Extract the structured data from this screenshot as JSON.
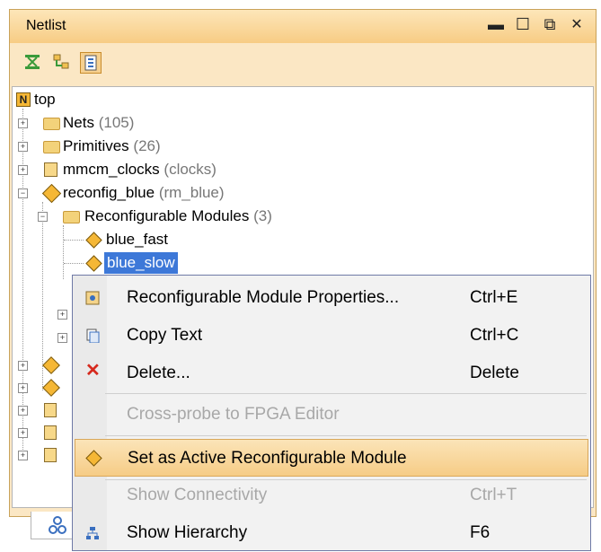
{
  "panel": {
    "title": "Netlist",
    "window_controls": [
      "minimize",
      "maximize",
      "restore",
      "close"
    ]
  },
  "toolbar": {
    "buttons": [
      {
        "icon": "collapse-all-icon"
      },
      {
        "icon": "expand-all-icon"
      },
      {
        "icon": "show-hierarchy-icon",
        "active": true
      }
    ]
  },
  "tree": {
    "root": {
      "label": "top",
      "icon": "netlist-n-icon"
    },
    "items": [
      {
        "label": "Nets",
        "count": "(105)",
        "icon": "folder-icon"
      },
      {
        "label": "Primitives",
        "count": "(26)",
        "icon": "folder-icon"
      },
      {
        "label": "mmcm_clocks",
        "count": "(clocks)",
        "icon": "instance-icon"
      },
      {
        "label": "reconfig_blue",
        "count": "(rm_blue)",
        "icon": "reconfig-partition-icon"
      },
      {
        "label": "Reconfigurable Modules",
        "count": "(3)",
        "icon": "folder-icon"
      },
      {
        "label": "blue_fast",
        "icon": "reconfig-module-icon"
      },
      {
        "label": "blue_slow",
        "icon": "reconfig-module-icon",
        "selected": true
      }
    ]
  },
  "context_menu": {
    "items": [
      {
        "label": "Reconfigurable Module Properties...",
        "shortcut": "Ctrl+E",
        "icon": "properties-icon",
        "enabled": true
      },
      {
        "label": "Copy Text",
        "shortcut": "Ctrl+C",
        "icon": "copy-icon",
        "enabled": true
      },
      {
        "label": "Delete...",
        "shortcut": "Delete",
        "icon": "delete-icon",
        "enabled": true
      },
      {
        "label": "Cross-probe to FPGA Editor",
        "shortcut": "",
        "icon": "",
        "enabled": false
      },
      {
        "label": "Set as Active Reconfigurable Module",
        "shortcut": "",
        "icon": "reconfig-module-icon",
        "enabled": true,
        "highlighted": true
      },
      {
        "label": "Show Connectivity",
        "shortcut": "Ctrl+T",
        "icon": "",
        "enabled": false
      },
      {
        "label": "Show Hierarchy",
        "shortcut": "F6",
        "icon": "hierarchy-icon",
        "enabled": true
      }
    ]
  },
  "colors": {
    "title_bar": "#f7cc84",
    "selection": "#3d78d8",
    "menu_highlight": "#f6cc86",
    "delete_red": "#d62a1e"
  }
}
